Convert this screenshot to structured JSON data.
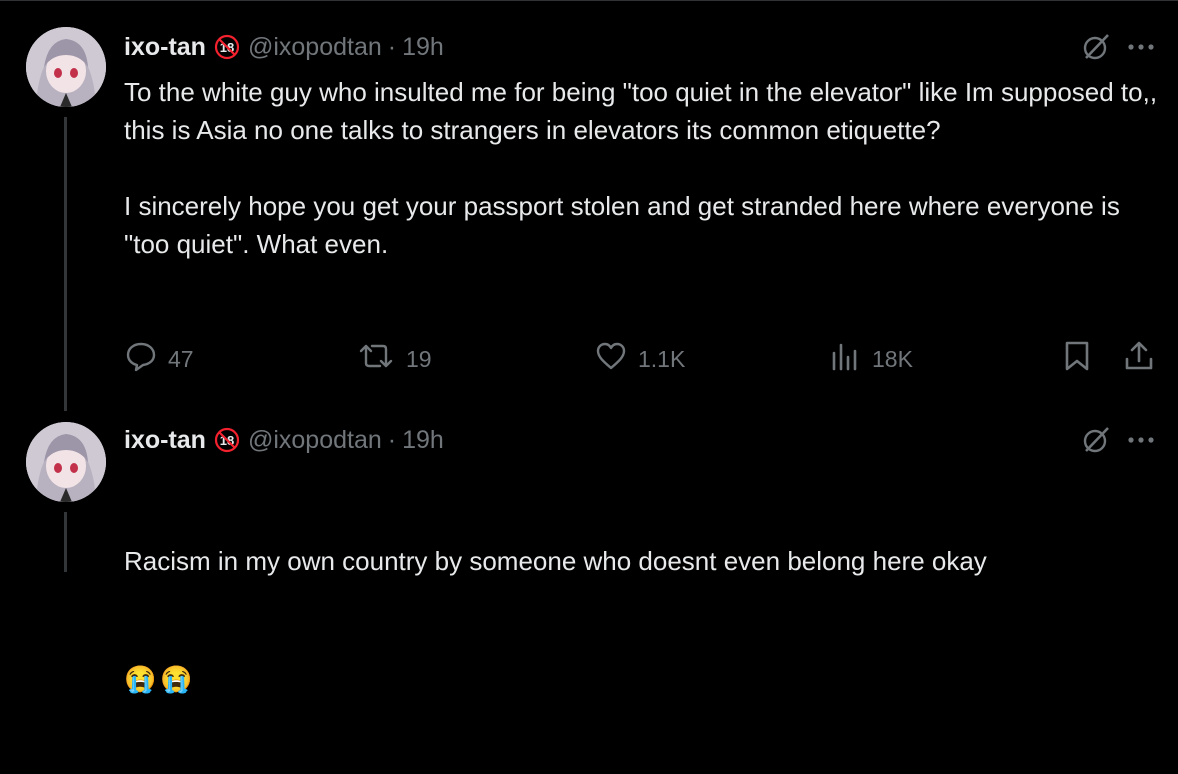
{
  "tweets": [
    {
      "name": "ixo-tan",
      "handle": "@ixopodtan",
      "separator": "·",
      "time": "19h",
      "text": "To the white guy who insulted me for being \"too quiet in the elevator\" like Im supposed to,, this is Asia no one talks to strangers in elevators its common etiquette?\n\nI sincerely hope you get your passport stolen and get stranded here where everyone is \"too quiet\". What even.",
      "stats": {
        "replies": "47",
        "reposts": "19",
        "likes": "1.1K",
        "views": "18K"
      }
    },
    {
      "name": "ixo-tan",
      "handle": "@ixopodtan",
      "separator": "·",
      "time": "19h",
      "text": "Racism in my own country by someone who doesnt even belong here okay",
      "emojis": [
        "😭",
        "😭"
      ]
    }
  ],
  "colors": {
    "background": "#000000",
    "text": "#e7e9ea",
    "muted": "#71767b",
    "thread_line": "#333639",
    "badge_red": "#f4212e"
  },
  "icons": {
    "badge": "no-18-icon",
    "grok": "grok-icon",
    "more": "more-icon",
    "reply": "reply-icon",
    "repost": "repost-icon",
    "like": "like-icon",
    "views": "views-icon",
    "bookmark": "bookmark-icon",
    "share": "share-icon"
  }
}
